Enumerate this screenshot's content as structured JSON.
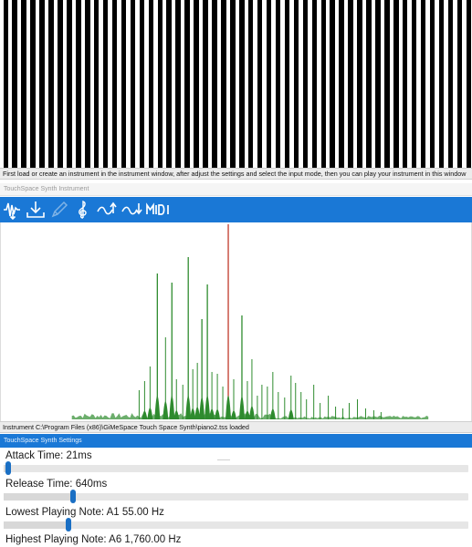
{
  "keyboard": {
    "white_key_count": 52,
    "black_key_color": "#000000"
  },
  "keyboard_status": "First load or create an instrument in the instrument window, after adjust the settings and select the input mode, then you can play your instrument in this window",
  "instrument_panel": {
    "title": "TouchSpace Synth Instrument",
    "toolbar": [
      {
        "name": "waveform-mode-icon",
        "enabled": true
      },
      {
        "name": "load-download-icon",
        "enabled": true
      },
      {
        "name": "pencil-edit-icon",
        "enabled": false
      },
      {
        "name": "treble-clef-icon",
        "enabled": true
      },
      {
        "name": "sweep-up-icon",
        "enabled": true
      },
      {
        "name": "sweep-down-icon",
        "enabled": true
      },
      {
        "name": "midi-icon",
        "label": "MIDI",
        "enabled": true
      }
    ],
    "status": "Instrument C:\\Program Files (x86)\\GiMeSpace Touch Space Synth\\piano2.tss loaded",
    "accent_color": "#1a78d6",
    "spectrum_color": "#2e8b2e",
    "highlight_color": "#c0392b"
  },
  "settings_panel": {
    "title": "TouchSpace Synth Settings",
    "items": [
      {
        "label": "Attack Time: 21ms",
        "value": 0.01
      },
      {
        "label": "Release Time: 640ms",
        "value": 0.15
      },
      {
        "label": "Lowest Playing Note: A1 55.00 Hz",
        "value": 0.14
      },
      {
        "label": "Highest Playing Note: A6 1,760.00 Hz"
      }
    ]
  }
}
